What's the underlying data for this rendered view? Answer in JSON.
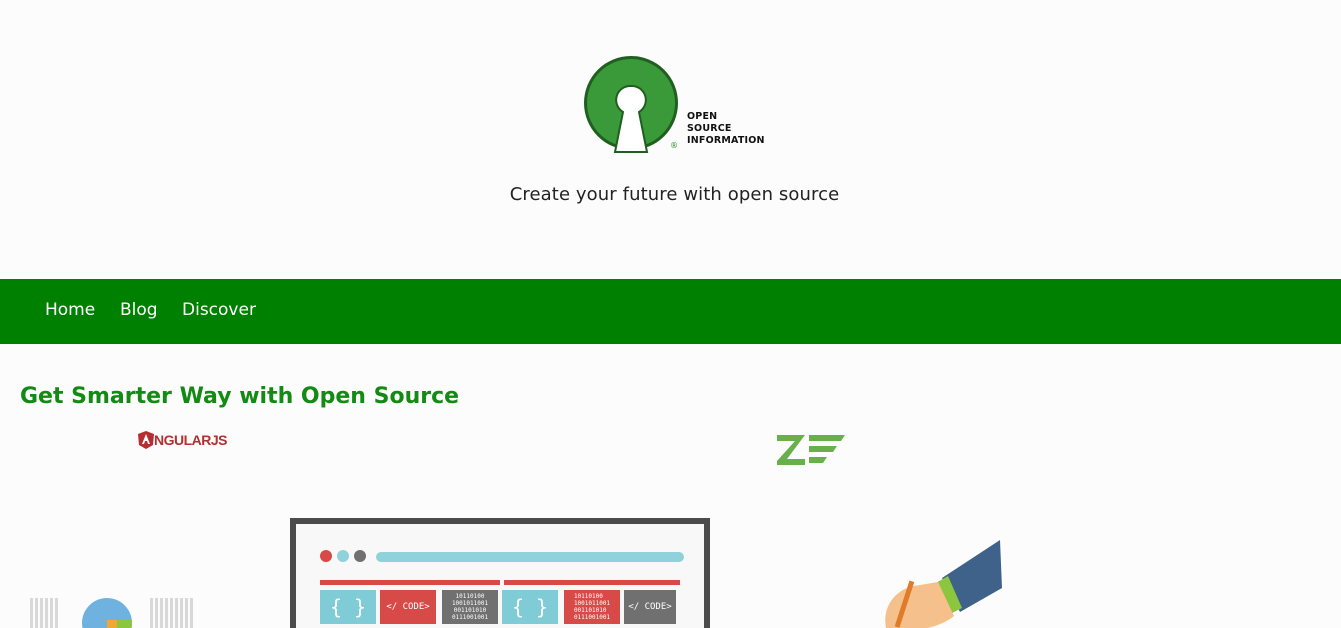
{
  "header": {
    "logo_lines": [
      "OPEN",
      "SOURCE",
      "INFORMATION"
    ],
    "logo_reg_mark": "®",
    "tagline": "Create your future with open source"
  },
  "nav": {
    "items": [
      {
        "label": "Home"
      },
      {
        "label": "Blog"
      },
      {
        "label": "Discover"
      }
    ]
  },
  "main": {
    "title": "Get Smarter Way with Open Source",
    "hero": {
      "angular_label": "NGULARJS",
      "code_blocks": {
        "brace": "{ }",
        "code_tag": "</ CODE>",
        "binary": "10110100\n1001011001\n001101010\n0111001001"
      }
    }
  },
  "colors": {
    "nav_bg": "#008000",
    "title": "#138a13",
    "logo_green": "#3a9a3a"
  }
}
